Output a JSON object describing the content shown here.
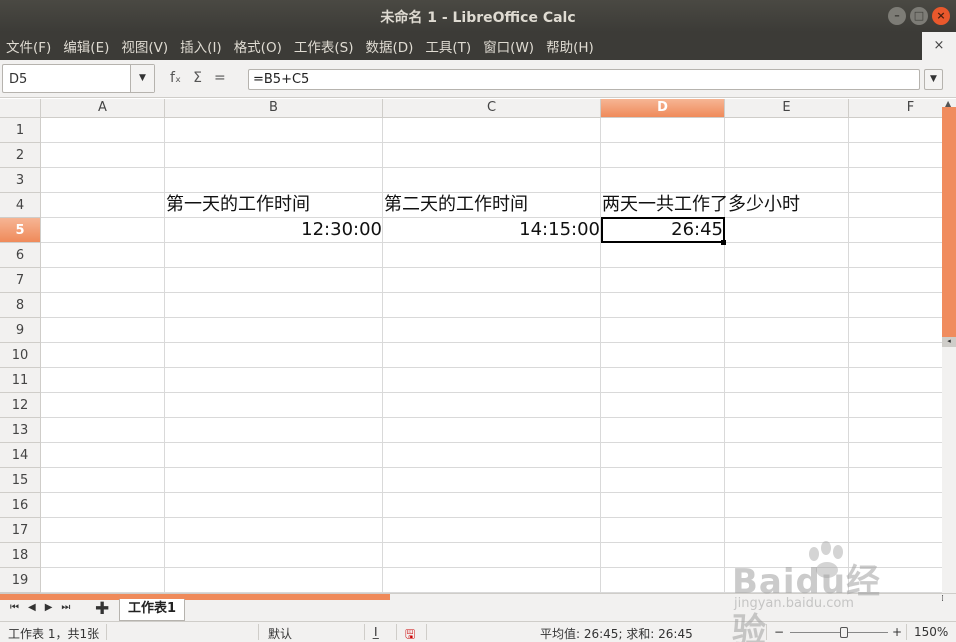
{
  "window": {
    "title": "未命名 1 - LibreOffice Calc",
    "controls": [
      "minimize-icon",
      "maximize-icon",
      "close-icon"
    ]
  },
  "menu": {
    "items": [
      "文件(F)",
      "编辑(E)",
      "视图(V)",
      "插入(I)",
      "格式(O)",
      "工作表(S)",
      "数据(D)",
      "工具(T)",
      "窗口(W)",
      "帮助(H)"
    ],
    "close_glyph": "×"
  },
  "formula_bar": {
    "name_box": "D5",
    "formula": "=B5+C5",
    "icons": [
      "function-wizard-icon",
      "sum-icon",
      "equals-icon"
    ],
    "fx_glyph": "fₓ",
    "sum_glyph": "Σ",
    "eq_glyph": "="
  },
  "sheet": {
    "columns": [
      "A",
      "B",
      "C",
      "D",
      "E",
      "F"
    ],
    "selected_column": "D",
    "rows": [
      "1",
      "2",
      "3",
      "4",
      "5",
      "6",
      "7",
      "8",
      "9",
      "10",
      "11",
      "12",
      "13",
      "14",
      "15",
      "16",
      "17",
      "18",
      "19"
    ],
    "selected_row": "5",
    "cells": {
      "B4": "第一天的工作时间",
      "C4": "第二天的工作时间",
      "D4": "两天一共工作了多少小时",
      "B5": "12:30:00",
      "C5": "14:15:00",
      "D5": "26:45"
    },
    "active_cell": "D5"
  },
  "tabs": {
    "sheet_name": "工作表1",
    "add_glyph": "✚"
  },
  "status": {
    "sheet_info": "工作表 1，共1张",
    "page_style": "默认",
    "selection_mode": "I̲",
    "summary": "平均值: 26:45; 求和: 26:45",
    "zoom_minus": "−",
    "zoom_plus": "+",
    "zoom": "150%"
  },
  "watermark": {
    "brand": "Baidu经验",
    "url": "jingyan.baidu.com"
  },
  "colors": {
    "accent": "#ef8a5a",
    "titlebar": "#3c3b37"
  }
}
